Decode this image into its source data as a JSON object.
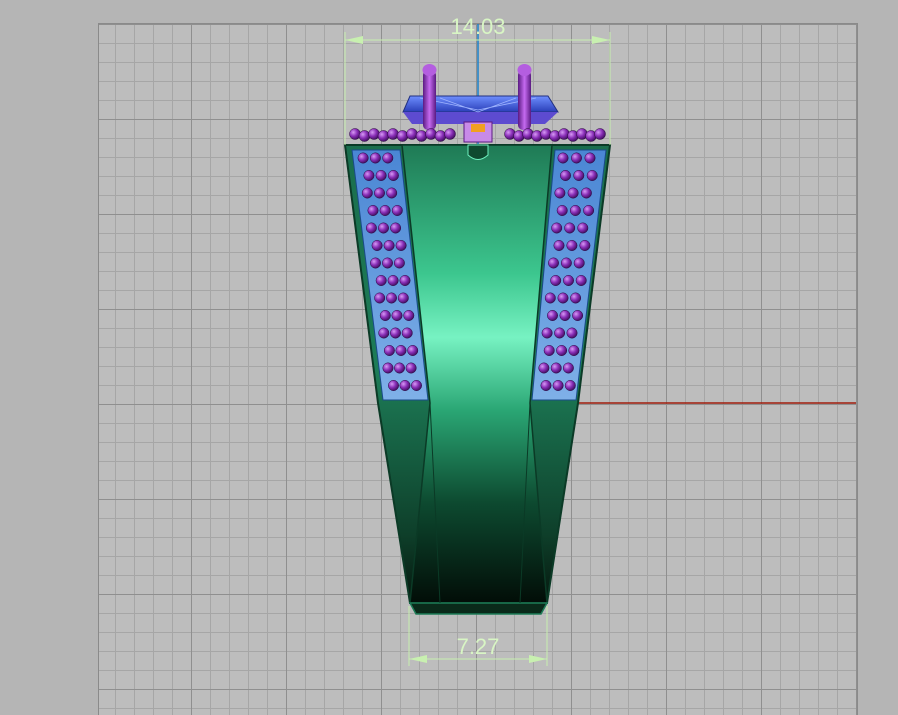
{
  "viewport": {
    "dimension_top": "14.03",
    "dimension_bottom": "7.27"
  },
  "colors": {
    "background": "#b5b5b5",
    "grid_fill": "#bdbdbd",
    "grid_major": "#8f8f8f",
    "grid_minor": "#a6a6a6",
    "x_axis": "#a01c0c",
    "y_axis": "#1c80c8",
    "dimension": "#c8f0b0",
    "ring_green": "#1d7c57",
    "ring_highlight": "#6ff0bf",
    "ring_dark": "#051b10",
    "gem_blue": "#3f69d6",
    "prong_purple": "#8a2fb8"
  },
  "icons": {
    "prong": "prong-icon",
    "stone": "stone-icon"
  }
}
